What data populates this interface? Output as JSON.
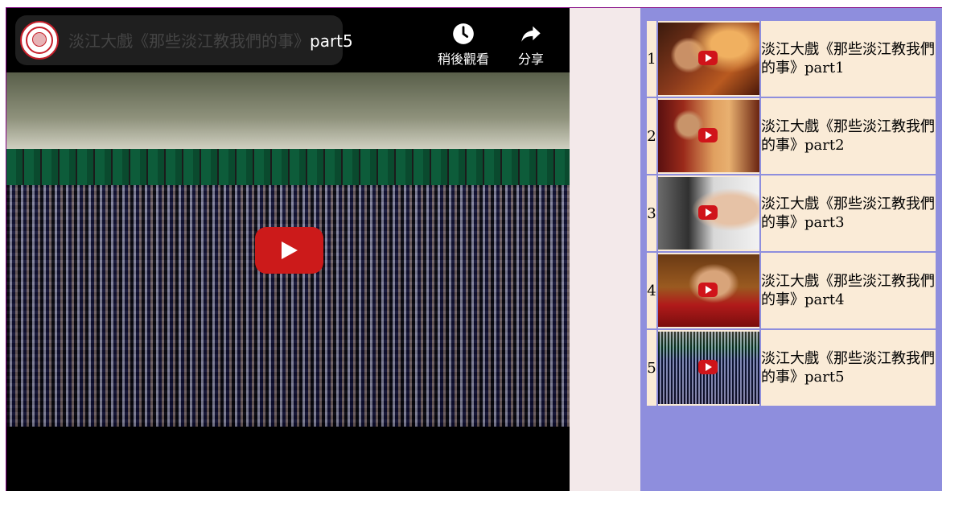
{
  "player": {
    "title_main": "淡江大戲《那些淡江教我們的事》",
    "title_tail": "part5",
    "actions": {
      "watch_later_label": "稍後觀看",
      "share_label": "分享"
    }
  },
  "playlist": {
    "items": [
      {
        "index": "1",
        "label": "淡江大戲《那些淡江教我們的事》part1"
      },
      {
        "index": "2",
        "label": "淡江大戲《那些淡江教我們的事》part2"
      },
      {
        "index": "3",
        "label": "淡江大戲《那些淡江教我們的事》part3"
      },
      {
        "index": "4",
        "label": "淡江大戲《那些淡江教我們的事》part4"
      },
      {
        "index": "5",
        "label": "淡江大戲《那些淡江教我們的事》part5"
      }
    ]
  },
  "colors": {
    "frame_border": "#800080",
    "playlist_panel": "#8e8edd",
    "cell_background": "#faebd7",
    "play_button": "#cc1a1a"
  },
  "icons": {
    "watch_later": "clock-icon",
    "share": "share-arrow-icon",
    "play": "play-icon",
    "channel": "channel-logo"
  }
}
